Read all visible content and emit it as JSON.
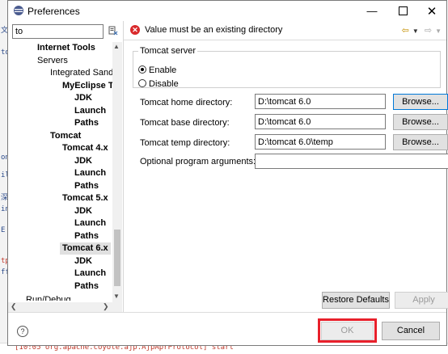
{
  "window": {
    "title": "Preferences"
  },
  "background": {
    "left_fragments": [
      "文",
      "⌘",
      "to",
      "on",
      "il",
      "深",
      "in",
      "E",
      "tp",
      "ff",
      "e",
      "a"
    ],
    "bottom_text": "[10:05 org.apache.coyote.ajp.AjpAprProtocol] start"
  },
  "filter": {
    "value": "to"
  },
  "tree": [
    {
      "label": "Internet Tools",
      "bold": true
    },
    {
      "label": "Servers",
      "bold": false
    },
    {
      "label": "Integrated Sand",
      "bold": false
    },
    {
      "label": "MyEclipse Te",
      "bold": true
    },
    {
      "label": "JDK",
      "bold": true
    },
    {
      "label": "Launch",
      "bold": true
    },
    {
      "label": "Paths",
      "bold": true
    },
    {
      "label": "Tomcat",
      "bold": true
    },
    {
      "label": "Tomcat  4.x",
      "bold": true
    },
    {
      "label": "JDK",
      "bold": true
    },
    {
      "label": "Launch",
      "bold": true
    },
    {
      "label": "Paths",
      "bold": true
    },
    {
      "label": "Tomcat  5.x",
      "bold": true
    },
    {
      "label": "JDK",
      "bold": true
    },
    {
      "label": "Launch",
      "bold": true
    },
    {
      "label": "Paths",
      "bold": true
    },
    {
      "label": "Tomcat  6.x",
      "bold": true,
      "selected": true
    },
    {
      "label": "JDK",
      "bold": true
    },
    {
      "label": "Launch",
      "bold": true
    },
    {
      "label": "Paths",
      "bold": true
    },
    {
      "label": "Run/Debug",
      "bold": false
    }
  ],
  "message": {
    "text": "Value must be an existing directory"
  },
  "server_group": {
    "legend": "Tomcat server",
    "enable_label": "Enable",
    "disable_label": "Disable",
    "selected": "Enable"
  },
  "fields": {
    "home_label": "Tomcat home directory:",
    "home_value": "D:\\tomcat 6.0",
    "base_label": "Tomcat base directory:",
    "base_value": "D:\\tomcat 6.0",
    "temp_label": "Tomcat temp directory:",
    "temp_value": "D:\\tomcat 6.0\\temp",
    "args_label": "Optional program arguments:",
    "args_value": ""
  },
  "buttons": {
    "browse": "Browse...",
    "restore_defaults": "Restore Defaults",
    "apply": "Apply",
    "ok": "OK",
    "cancel": "Cancel"
  },
  "colors": {
    "error": "#d9292b",
    "highlight": "#e8202b",
    "focus": "#0078d7"
  }
}
